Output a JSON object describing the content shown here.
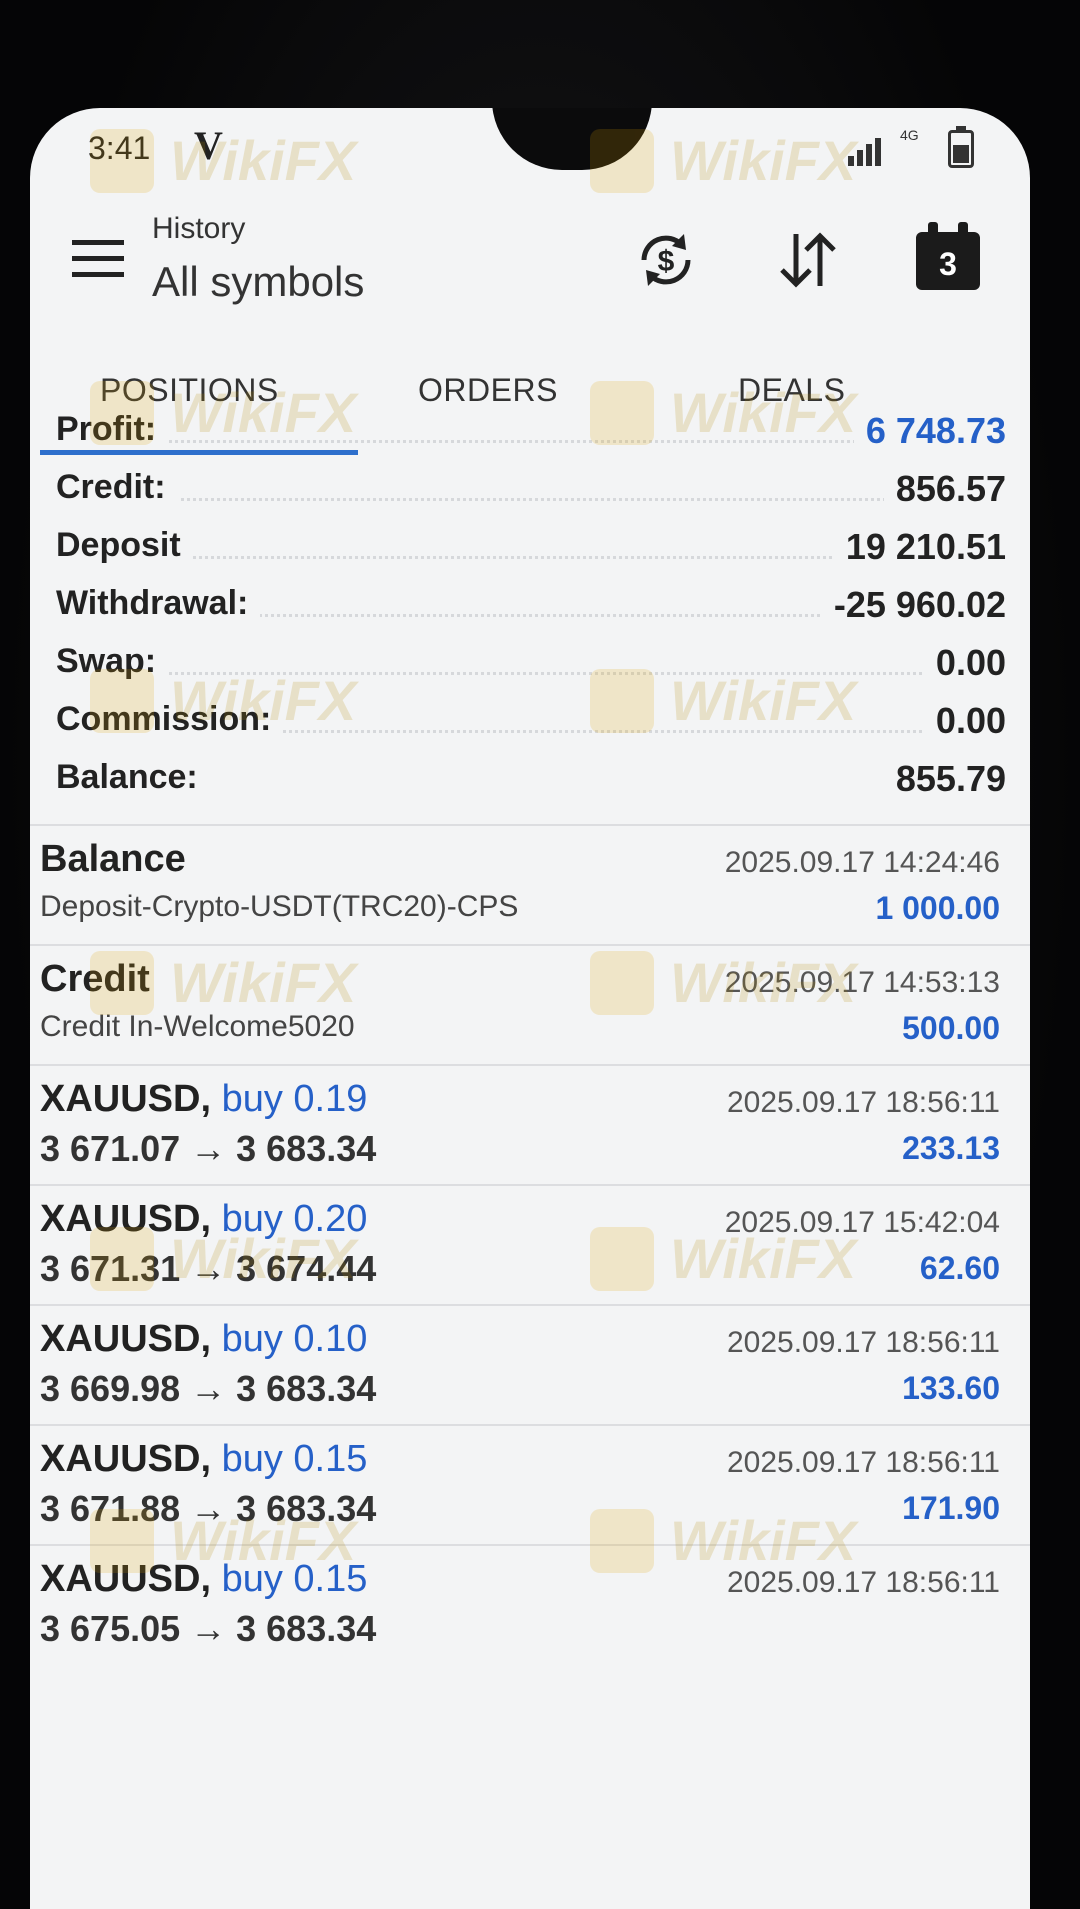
{
  "status_bar": {
    "time": "3:41",
    "carrier_glyph": "V",
    "network": "4G"
  },
  "header": {
    "title": "History",
    "subtitle": "All symbols",
    "icons": [
      "menu-icon",
      "currency-sync-icon",
      "sort-icon",
      "calendar-icon"
    ],
    "calendar_day": "3"
  },
  "tabs": [
    {
      "label": "POSITIONS",
      "active": true
    },
    {
      "label": "ORDERS",
      "active": false
    },
    {
      "label": "DEALS",
      "active": false
    }
  ],
  "summary": [
    {
      "label": "Profit:",
      "value": "6 748.73",
      "highlight": true
    },
    {
      "label": "Credit:",
      "value": "856.57"
    },
    {
      "label": "Deposit",
      "value": "19 210.51"
    },
    {
      "label": "Withdrawal:",
      "value": "-25 960.02"
    },
    {
      "label": "Swap:",
      "value": "0.00"
    },
    {
      "label": "Commission:",
      "value": "0.00"
    },
    {
      "label": "Balance:",
      "value": "855.79"
    }
  ],
  "records": [
    {
      "title": "Balance",
      "detail": "Deposit-Crypto-USDT(TRC20)-CPS",
      "datetime": "2025.09.17 14:24:46",
      "amount": "1 000.00"
    },
    {
      "title": "Credit",
      "detail": "Credit In-Welcome5020",
      "datetime": "2025.09.17 14:53:13",
      "amount": "500.00"
    }
  ],
  "trades": [
    {
      "symbol": "XAUUSD,",
      "direction": "buy 0.19",
      "prices": "3 671.07 → 3 683.34",
      "datetime": "2025.09.17 18:56:11",
      "profit": "233.13"
    },
    {
      "symbol": "XAUUSD,",
      "direction": "buy 0.20",
      "prices": "3 671.31 → 3 674.44",
      "datetime": "2025.09.17 15:42:04",
      "profit": "62.60"
    },
    {
      "symbol": "XAUUSD,",
      "direction": "buy 0.10",
      "prices": "3 669.98 → 3 683.34",
      "datetime": "2025.09.17 18:56:11",
      "profit": "133.60"
    },
    {
      "symbol": "XAUUSD,",
      "direction": "buy 0.15",
      "prices": "3 671.88 → 3 683.34",
      "datetime": "2025.09.17 18:56:11",
      "profit": "171.90"
    },
    {
      "symbol": "XAUUSD,",
      "direction": "buy 0.15",
      "prices": "3 675.05 → 3 683.34",
      "datetime": "2025.09.17 18:56:11",
      "profit": ""
    }
  ],
  "watermark": {
    "text": "WikiFX",
    "color": "#e0a300"
  },
  "colors": {
    "accent": "#2560c8",
    "tab_indicator": "#2d6fcc"
  }
}
